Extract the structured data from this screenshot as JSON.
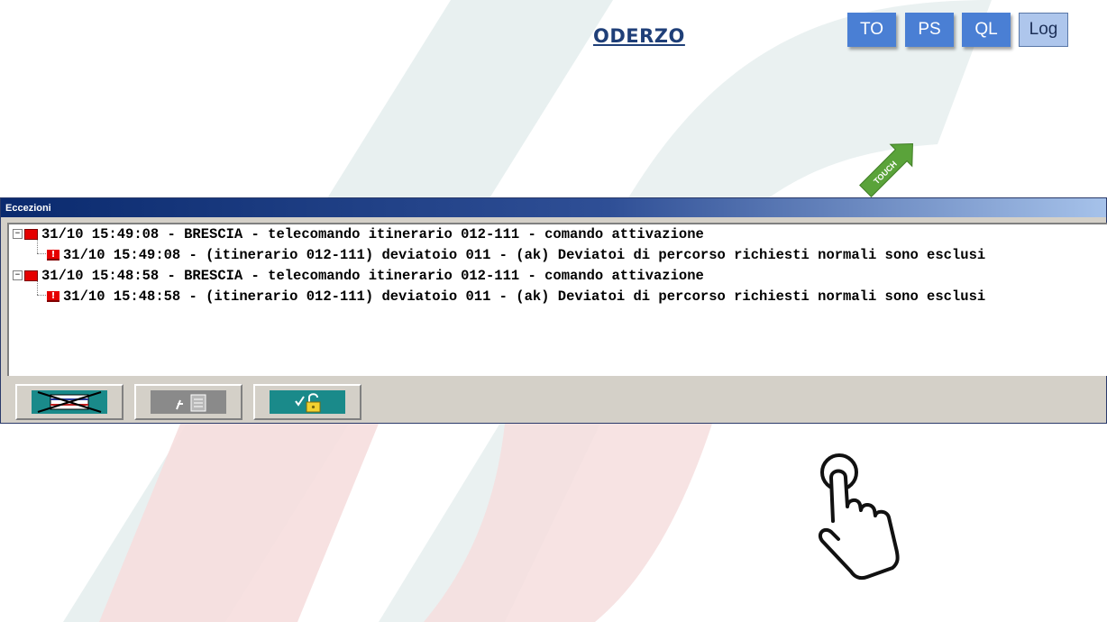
{
  "header": {
    "title": "ODERZO",
    "buttons": [
      {
        "label": "TO"
      },
      {
        "label": "PS"
      },
      {
        "label": "QL"
      },
      {
        "label": "Log"
      }
    ],
    "touch_label": "TOUCH"
  },
  "panel": {
    "title": "Eccezioni",
    "rows": [
      {
        "level": 0,
        "text": "31/10 15:49:08 - BRESCIA - telecomando itinerario 012-111 - comando attivazione"
      },
      {
        "level": 1,
        "text": "31/10 15:49:08 - (itinerario 012-111) deviatoio 011 - (ak) Deviatoi di percorso richiesti normali sono esclusi"
      },
      {
        "level": 0,
        "text": "31/10 15:48:58 - BRESCIA - telecomando itinerario 012-111 - comando attivazione"
      },
      {
        "level": 1,
        "text": "31/10 15:48:58 - (itinerario 012-111) deviatoio 011 - (ak) Deviatoi di percorso richiesti normali sono esclusi"
      }
    ],
    "toolbar": [
      {
        "icon": "cancel-flag-icon"
      },
      {
        "icon": "acknowledge-document-icon"
      },
      {
        "icon": "unlock-confirm-icon"
      }
    ]
  },
  "colors": {
    "title": "#1f3f78",
    "button": "#4a7fd4",
    "log_button": "#aec6ec",
    "touch_arrow": "#5aa33a",
    "panel_title_start": "#0a2a6e",
    "panel_title_end": "#a6c2ea",
    "toolbar_icon_bg": "#1a8a8a"
  }
}
